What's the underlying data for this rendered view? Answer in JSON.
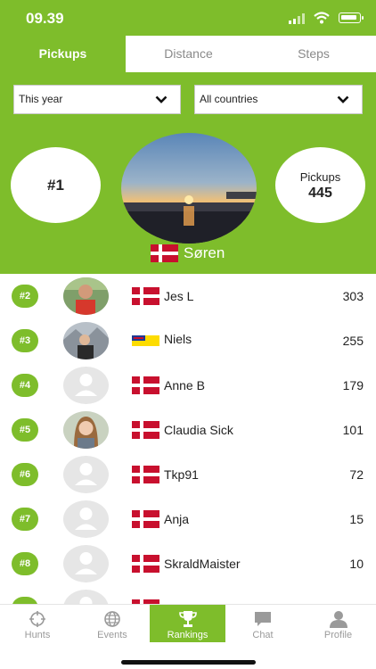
{
  "status": {
    "time": "09.39"
  },
  "tabs": [
    {
      "label": "Pickups",
      "active": true
    },
    {
      "label": "Distance",
      "active": false
    },
    {
      "label": "Steps",
      "active": false
    }
  ],
  "filters": {
    "period": "This year",
    "country": "All countries"
  },
  "me": {
    "rank": "#1",
    "metric_label": "Pickups",
    "metric_value": "445",
    "name": "Søren",
    "flag": "denmark"
  },
  "ranking": [
    {
      "rank": "#2",
      "name": "Jes L",
      "score": "303",
      "flag": "denmark",
      "avatar": "photo"
    },
    {
      "rank": "#3",
      "name": "Niels",
      "score": "255",
      "flag": "kiribati",
      "avatar": "photo"
    },
    {
      "rank": "#4",
      "name": "Anne B",
      "score": "179",
      "flag": "denmark",
      "avatar": "placeholder"
    },
    {
      "rank": "#5",
      "name": "Claudia Sick",
      "score": "101",
      "flag": "denmark",
      "avatar": "photo"
    },
    {
      "rank": "#6",
      "name": "Tkp91",
      "score": "72",
      "flag": "denmark",
      "avatar": "placeholder"
    },
    {
      "rank": "#7",
      "name": "Anja",
      "score": "15",
      "flag": "denmark",
      "avatar": "placeholder"
    },
    {
      "rank": "#8",
      "name": "SkraldMaister",
      "score": "10",
      "flag": "denmark",
      "avatar": "placeholder"
    },
    {
      "rank": "",
      "name": "",
      "score": "",
      "flag": "denmark",
      "avatar": "placeholder"
    }
  ],
  "tabbar": [
    {
      "label": "Hunts",
      "icon": "crosshair-icon",
      "active": false
    },
    {
      "label": "Events",
      "icon": "globe-icon",
      "active": false
    },
    {
      "label": "Rankings",
      "icon": "trophy-icon",
      "active": true
    },
    {
      "label": "Chat",
      "icon": "chat-bubble-icon",
      "active": false
    },
    {
      "label": "Profile",
      "icon": "person-icon",
      "active": false
    }
  ],
  "colors": {
    "accent": "#7ebd2b",
    "inactive_text": "#9a9a9a"
  }
}
